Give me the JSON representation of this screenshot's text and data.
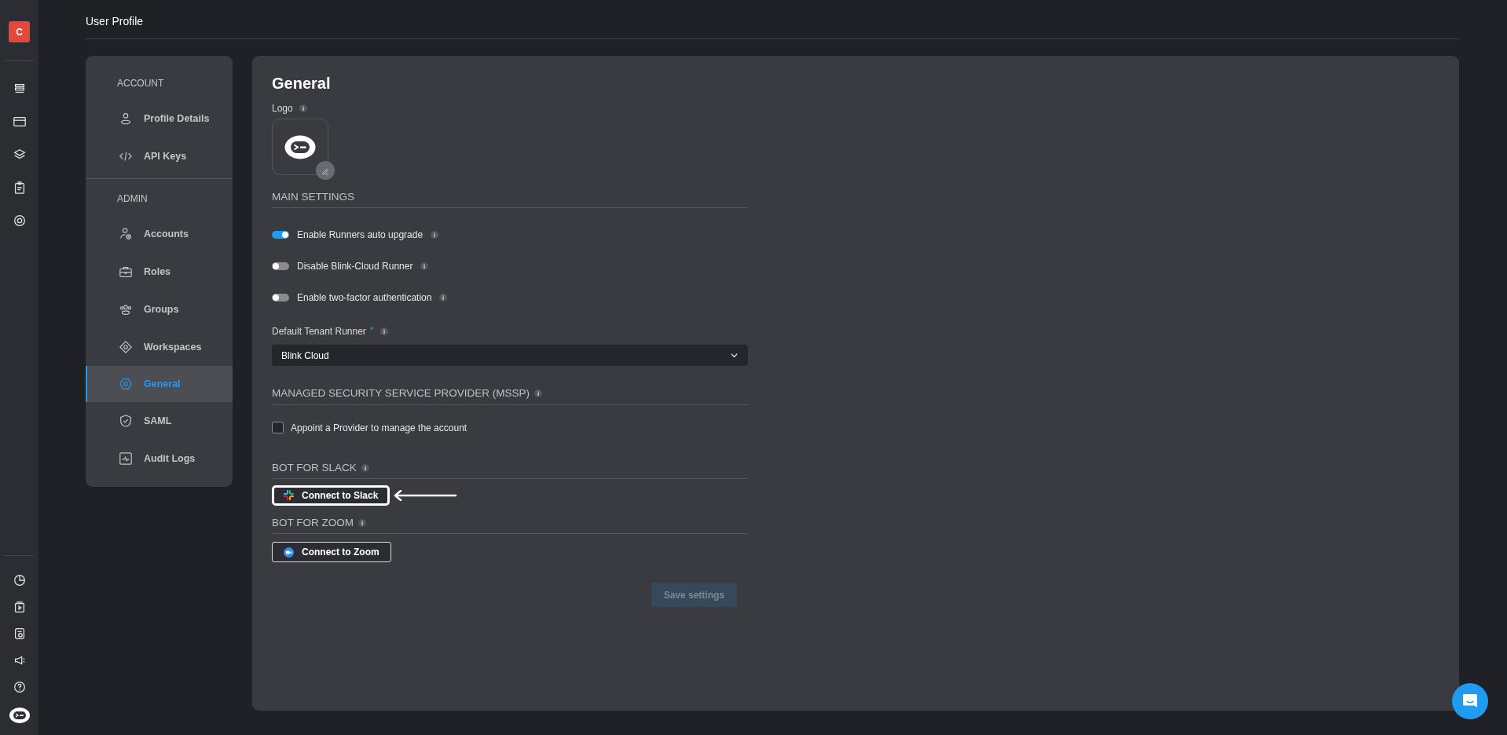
{
  "rail": {
    "avatar": "C"
  },
  "page_title": "User Profile",
  "sidebar": {
    "sections": [
      {
        "heading": "ACCOUNT",
        "items": [
          {
            "label": "Profile Details",
            "selected": false
          },
          {
            "label": "API Keys",
            "selected": false
          }
        ]
      },
      {
        "heading": "ADMIN",
        "items": [
          {
            "label": "Accounts",
            "selected": false
          },
          {
            "label": "Roles",
            "selected": false
          },
          {
            "label": "Groups",
            "selected": false
          },
          {
            "label": "Workspaces",
            "selected": false
          },
          {
            "label": "General",
            "selected": true
          },
          {
            "label": "SAML",
            "selected": false
          },
          {
            "label": "Audit Logs",
            "selected": false
          }
        ]
      }
    ]
  },
  "panel": {
    "title": "General",
    "logo": {
      "label": "Logo",
      "info": true
    },
    "main_settings": {
      "heading": "MAIN SETTINGS",
      "toggles": [
        {
          "label": "Enable Runners auto upgrade",
          "on": true,
          "info": true
        },
        {
          "label": "Disable Blink-Cloud Runner",
          "on": false,
          "info": true
        },
        {
          "label": "Enable two-factor authentication",
          "on": false,
          "info": true
        }
      ],
      "select": {
        "label": "Default Tenant Runner",
        "required": true,
        "info": true,
        "value": "Blink Cloud"
      }
    },
    "mssp": {
      "heading": "MANAGED SECURITY SERVICE PROVIDER (MSSP)",
      "info": true,
      "checkbox": {
        "label": "Appoint a Provider to manage the account",
        "checked": false
      }
    },
    "bots": [
      {
        "heading": "BOT FOR SLACK",
        "info": true,
        "kind": "slack",
        "button": "Connect to Slack",
        "highlighted": true
      },
      {
        "heading": "BOT FOR ZOOM",
        "info": true,
        "kind": "zoom",
        "button": "Connect to Zoom",
        "highlighted": false
      }
    ],
    "save": {
      "label": "Save settings",
      "disabled": true
    }
  }
}
